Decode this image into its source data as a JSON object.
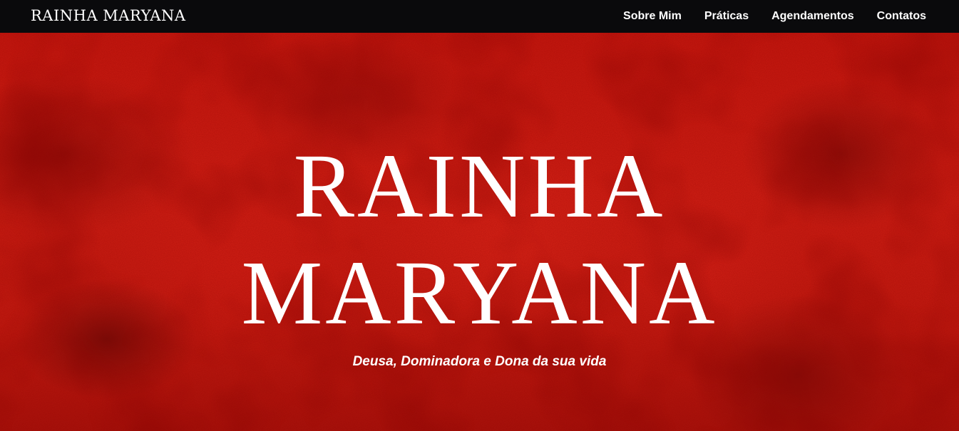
{
  "header": {
    "brand": "RAINHA MARYANA",
    "nav": [
      {
        "label": "Sobre Mim"
      },
      {
        "label": "Práticas"
      },
      {
        "label": "Agendamentos"
      },
      {
        "label": "Contatos"
      }
    ]
  },
  "hero": {
    "title_line1": "RAINHA",
    "title_line2": "MARYANA",
    "subtitle": "Deusa, Dominadora e Dona da sua vida"
  },
  "colors": {
    "header_bg": "#0a0a0c",
    "hero_red": "#cf1f14",
    "text": "#ffffff"
  }
}
